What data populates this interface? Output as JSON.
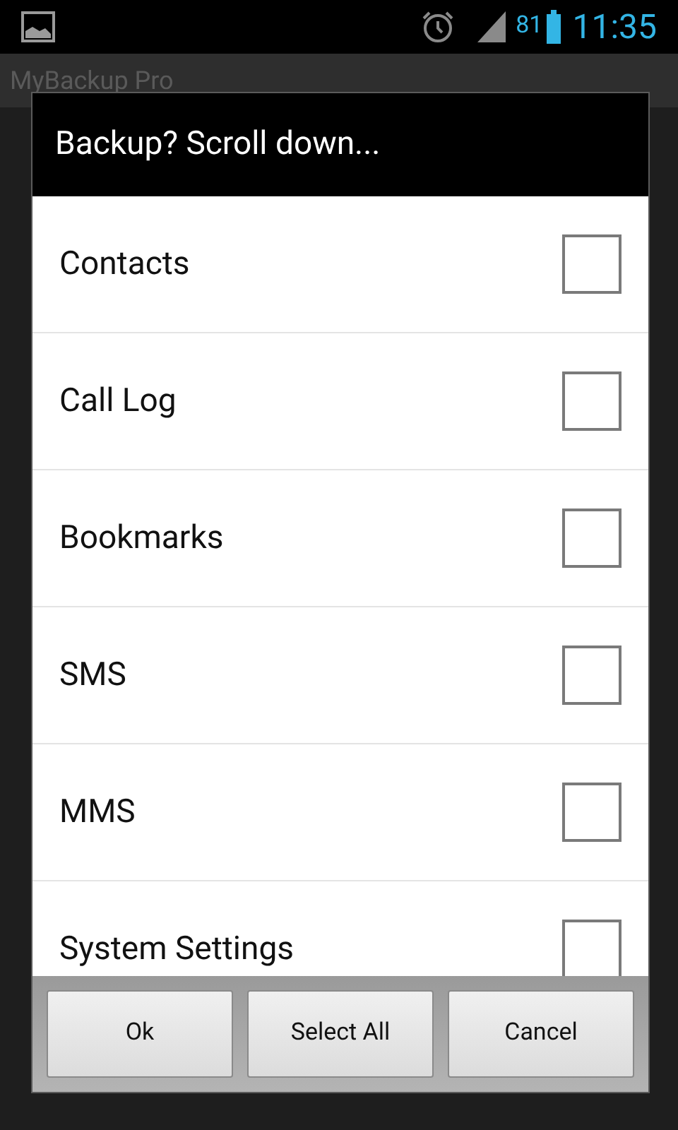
{
  "status_bar": {
    "battery": "81",
    "time": "11:35"
  },
  "app": {
    "title": "MyBackup Pro"
  },
  "dialog": {
    "title": "Backup? Scroll down...",
    "items": [
      {
        "label": "Contacts",
        "checked": false
      },
      {
        "label": "Call Log",
        "checked": false
      },
      {
        "label": "Bookmarks",
        "checked": false
      },
      {
        "label": "SMS",
        "checked": false
      },
      {
        "label": "MMS",
        "checked": false
      },
      {
        "label": "System Settings",
        "checked": false
      }
    ],
    "buttons": [
      "Ok",
      "Select All",
      "Cancel"
    ]
  }
}
